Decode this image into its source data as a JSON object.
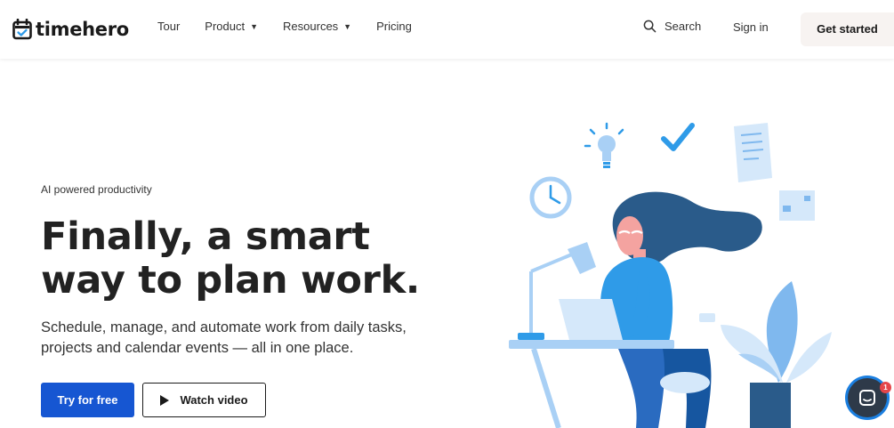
{
  "brand": {
    "name": "timehero"
  },
  "nav": {
    "links": [
      {
        "label": "Tour",
        "has_dropdown": false
      },
      {
        "label": "Product",
        "has_dropdown": true
      },
      {
        "label": "Resources",
        "has_dropdown": true
      },
      {
        "label": "Pricing",
        "has_dropdown": false
      }
    ],
    "search_label": "Search",
    "signin_label": "Sign in",
    "cta_label": "Get started"
  },
  "hero": {
    "eyebrow": "AI powered productivity",
    "headline_line1": "Finally, a smart",
    "headline_line2": "way to plan work.",
    "subtext": "Schedule, manage, and automate work from daily tasks, projects and calendar events — all in one place.",
    "primary_cta": "Try for free",
    "secondary_cta": "Watch video"
  },
  "chat": {
    "badge_count": "1"
  },
  "colors": {
    "primary_blue": "#1656d2",
    "illustration_light_blue": "#a9d0f5",
    "illustration_mid_blue": "#2f9be8",
    "illustration_dark_blue": "#2a5b8a",
    "cta_bg": "#f7f3f1"
  }
}
